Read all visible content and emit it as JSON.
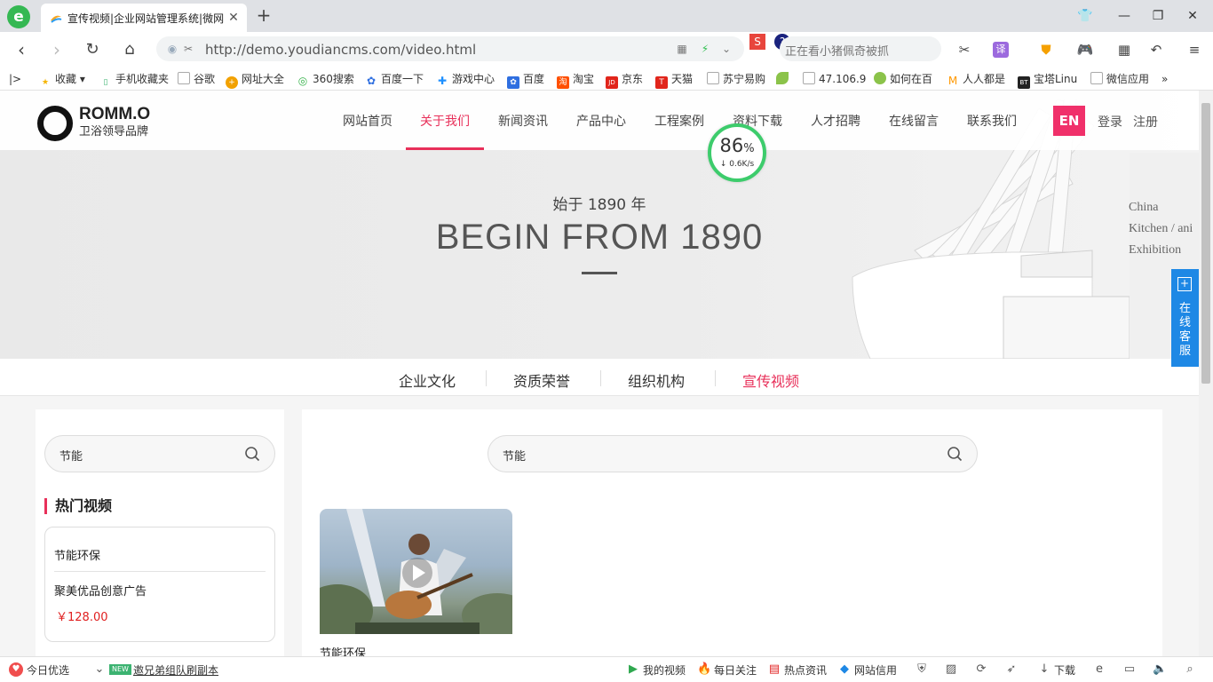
{
  "browser": {
    "tab_title": "宣传视频|企业网站管理系统|微网",
    "url": "http://demo.youdiancms.com/video.html",
    "search_placeholder": "正在看小猪佩奇被抓"
  },
  "bookmarks": [
    {
      "label": "收藏",
      "color": "#f5b400",
      "glyph": "★"
    },
    {
      "label": "手机收藏夹",
      "color": "#3cb371",
      "glyph": "▯"
    },
    {
      "label": "谷歌",
      "color": "#bbbbbb",
      "glyph": ""
    },
    {
      "label": "网址大全",
      "color": "#f2a100",
      "glyph": "+"
    },
    {
      "label": "360搜索",
      "color": "#36b24a",
      "glyph": "Q"
    },
    {
      "label": "百度一下",
      "color": "#2f6fe0",
      "glyph": "✿"
    },
    {
      "label": "游戏中心",
      "color": "#1e90ff",
      "glyph": "✚"
    },
    {
      "label": "百度",
      "color": "#2f6fe0",
      "glyph": "✿"
    },
    {
      "label": "淘宝",
      "color": "#ff5000",
      "glyph": "淘"
    },
    {
      "label": "京东",
      "color": "#e1251b",
      "glyph": "JD"
    },
    {
      "label": "天猫",
      "color": "#e1251b",
      "glyph": "T"
    },
    {
      "label": "苏宁易购",
      "color": "#bbbbbb",
      "glyph": ""
    },
    {
      "label": "",
      "color": "#8bc34a",
      "glyph": ""
    },
    {
      "label": "47.106.9",
      "color": "#bbbbbb",
      "glyph": ""
    },
    {
      "label": "如何在百",
      "color": "#8bc34a",
      "glyph": ""
    },
    {
      "label": "人人都是",
      "color": "#ff9800",
      "glyph": "M"
    },
    {
      "label": "宝塔Linu",
      "color": "#222222",
      "glyph": "BT"
    },
    {
      "label": "微信应用",
      "color": "#bbbbbb",
      "glyph": ""
    }
  ],
  "site": {
    "logo_name": "ROMM.O",
    "logo_sub": "卫浴领导品牌",
    "menu": [
      "网站首页",
      "关于我们",
      "新闻资讯",
      "产品中心",
      "工程案例",
      "资料下载",
      "人才招聘",
      "在线留言",
      "联系我们"
    ],
    "active_menu": "关于我们",
    "lang_button": "EN",
    "login": "登录",
    "register": "注册",
    "speed_percent": "86",
    "speed_unit": "%",
    "speed_rate": "↓ 0.6K/s",
    "banner_sub": "始于 1890 年",
    "banner_title": "BEGIN FROM 1890",
    "banner_art_lines": [
      "China",
      "Kitchen / ani",
      "Exhibition"
    ],
    "online_service": "在线客服",
    "subnav": [
      "企业文化",
      "资质荣誉",
      "组织机构",
      "宣传视频"
    ],
    "active_subnav": "宣传视频",
    "sidebar_search_value": "节能",
    "hot_title": "热门视频",
    "hot_items": [
      "节能环保",
      "聚美优品创意广告"
    ],
    "hot_price": "￥128.00",
    "main_search_value": "节能",
    "video_title": "节能环保"
  },
  "statusbar": {
    "left_1": "今日优选",
    "new_badge": "NEW",
    "left_2": "邀兄弟组队刷副本",
    "right": [
      "我的视频",
      "每日关注",
      "热点资讯",
      "网站信用",
      "下载"
    ]
  }
}
